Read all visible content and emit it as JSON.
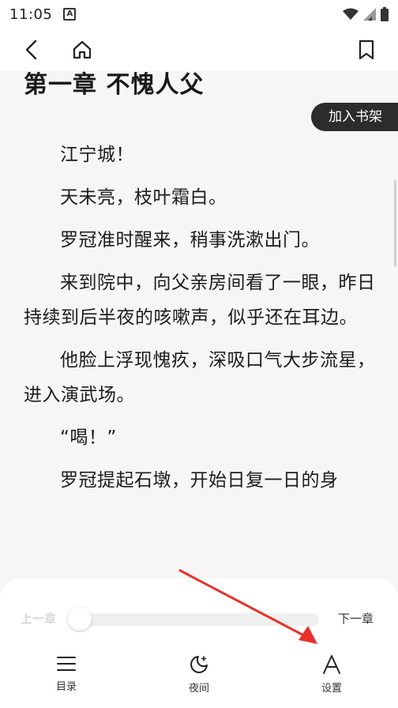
{
  "status_bar": {
    "time": "11:05",
    "notification_icon_letter": "A",
    "icons": [
      "wifi-icon",
      "signal-icon",
      "battery-icon"
    ]
  },
  "top_nav": {
    "back_icon": "back-arrow-icon",
    "home_icon": "home-icon",
    "bookmark_icon": "bookmark-icon"
  },
  "reader": {
    "chapter_title": "第一章 不愧人父",
    "add_to_shelf": "加入书架",
    "paragraphs": [
      "江宁城！",
      "天未亮，枝叶霜白。",
      "罗冠准时醒来，稍事洗漱出门。",
      "来到院中，向父亲房间看了一眼，昨日持续到后半夜的咳嗽声，似乎还在耳边。",
      "他脸上浮现愧疚，深吸口气大步流星，进入演武场。",
      "“喝！”",
      "罗冠提起石墩，开始日复一日的身"
    ]
  },
  "bottom_panel": {
    "prev_chapter": "上一章",
    "next_chapter": "下一章",
    "progress_fraction": 0.0,
    "tabs": [
      {
        "icon": "menu-list-icon",
        "label": "目录"
      },
      {
        "icon": "night-mode-icon",
        "label": "夜间"
      },
      {
        "icon": "font-settings-icon",
        "label": "设置"
      }
    ]
  },
  "colors": {
    "page_background": "#f6f6f6",
    "panel_background": "#ffffff",
    "shelf_button": "#2c2c2c",
    "annotation_arrow": "#e8322b"
  }
}
